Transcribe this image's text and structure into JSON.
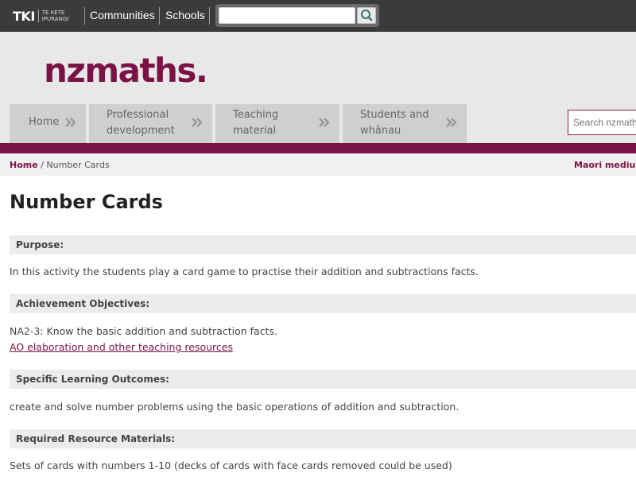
{
  "topbar": {
    "logo_mark": "TKI",
    "logo_sub": "TE KETE IPURANGI",
    "links": [
      "Communities",
      "Schools"
    ],
    "search_placeholder": ""
  },
  "header": {
    "brand": "nzmaths.",
    "nav": [
      {
        "line1": "Home",
        "line2": ""
      },
      {
        "line1": "Professional",
        "line2": "development"
      },
      {
        "line1": "Teaching",
        "line2": "material"
      },
      {
        "line1": "Students and",
        "line2": "whānau"
      }
    ],
    "site_search_placeholder": "Search nzmaths"
  },
  "breadcrumb": {
    "home": "Home",
    "separator": "/",
    "current": "Number Cards",
    "right_link": "Maori medium c"
  },
  "page": {
    "title": "Number Cards",
    "sections": [
      {
        "heading": "Purpose:",
        "lines": [
          "In this activity the students play a card game to practise their addition and subtractions facts."
        ]
      },
      {
        "heading": "Achievement Objectives:",
        "lines": [
          "NA2-3: Know the basic addition and subtraction facts."
        ],
        "link": "AO elaboration and other teaching resources"
      },
      {
        "heading": "Specific Learning Outcomes:",
        "lines": [
          "create and solve number problems using the basic operations of addition and subtraction."
        ]
      },
      {
        "heading": "Required Resource Materials:",
        "lines": [
          "Sets of cards with numbers 1-10 (decks of cards with face cards removed could be used)"
        ]
      }
    ]
  },
  "colors": {
    "brand": "#7b1246",
    "topbar": "#3b3b3b",
    "header_bg": "#e8e8e8",
    "nav_tab": "#cfcfcf"
  },
  "icons": [
    "search-icon",
    "double-chevron-right-icon"
  ]
}
